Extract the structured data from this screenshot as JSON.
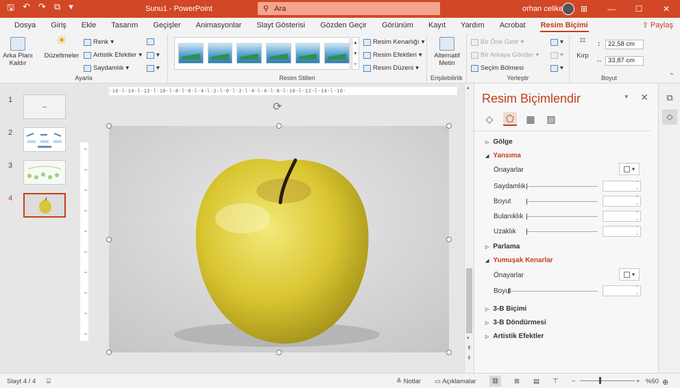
{
  "titlebar": {
    "doc_title": "Sunu1 - PowerPoint",
    "search_placeholder": "Ara",
    "user_name": "orhan celiker",
    "icons": [
      "save-icon",
      "undo-icon",
      "redo-icon",
      "start-from-beginning-icon",
      "qat-dropdown-icon"
    ]
  },
  "tabs": [
    "Dosya",
    "Giriş",
    "Ekle",
    "Tasarım",
    "Geçişler",
    "Animasyonlar",
    "Slayt Gösterisi",
    "Gözden Geçir",
    "Görünüm",
    "Kayıt",
    "Yardım",
    "Acrobat",
    "Resim Biçimi"
  ],
  "active_tab": "Resim Biçimi",
  "share_label": "Paylaş",
  "ribbon": {
    "ayarla": {
      "remove_bg": "Arka Planı Kaldır",
      "corrections": "Düzeltmeler",
      "color": "Renk",
      "artistic": "Artistik Efektler",
      "transparency": "Saydamlık",
      "label": "Ayarla"
    },
    "styles": {
      "border": "Resim Kenarlığı",
      "effects": "Resim Efektleri",
      "layout": "Resim Düzeni",
      "label": "Resim Stilleri"
    },
    "access": {
      "alt_text": "Alternatif Metin",
      "label": "Erişilebilirlik"
    },
    "arrange": {
      "bring_forward": "Bir Öne Getir",
      "send_backward": "Bir Arkaya Gönder",
      "selection_pane": "Seçim Bölmesi",
      "label": "Yerleştir"
    },
    "size": {
      "crop": "Kırp",
      "height": "22,58 cm",
      "width": "33,87 cm",
      "label": "Boyut"
    }
  },
  "slides": [
    {
      "num": "1"
    },
    {
      "num": "2"
    },
    {
      "num": "3"
    },
    {
      "num": "4"
    }
  ],
  "ruler_text": "·16·l·14·l·12·l·10·l·8·l·6·l·4·l·2·l·0·l·2·l·4·l·6·l·8·l·10·l·12·l·14·l·16·",
  "format_pane": {
    "title": "Resim Biçimlendir",
    "sections": {
      "shadow": "Gölge",
      "reflection": "Yansıma",
      "glow": "Parlama",
      "soft_edges": "Yumuşak Kenarlar",
      "format3d": "3-B Biçimi",
      "rotation3d": "3-B Döndürmesi",
      "artistic": "Artistik Efektler"
    },
    "props": {
      "presets": "Önayarlar",
      "transparency": "Saydamlık",
      "size": "Boyut",
      "blur": "Bulanıklık",
      "distance": "Uzaklık",
      "presets2": "Önayarlar",
      "size2": "Boyut"
    }
  },
  "status": {
    "slide": "Slayt 4 / 4",
    "notes": "Notlar",
    "comments": "Açıklamalar",
    "zoom": "%50"
  }
}
